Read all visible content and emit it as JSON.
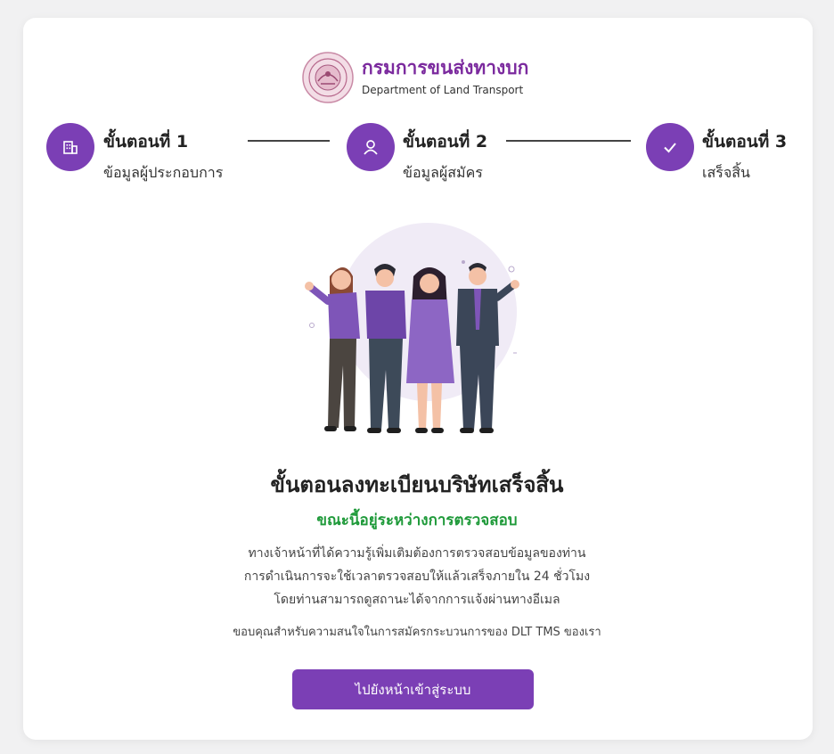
{
  "header": {
    "agency_name_th": "กรมการขนส่งทางบก",
    "agency_name_en": "Department of Land Transport",
    "logo_icon": "dlt-seal-logo"
  },
  "steps": [
    {
      "title": "ขั้นตอนที่ 1",
      "subtitle": "ข้อมูลผู้ประกอบการ",
      "icon": "building-icon",
      "state": "completed"
    },
    {
      "title": "ขั้นตอนที่ 2",
      "subtitle": "ข้อมูลผู้สมัคร",
      "icon": "user-icon",
      "state": "completed"
    },
    {
      "title": "ขั้นตอนที่ 3",
      "subtitle": "เสร็จสิ้น",
      "icon": "check-icon",
      "state": "active"
    }
  ],
  "result": {
    "title": "ขั้นตอนลงทะเบียนบริษัทเสร็จสิ้น",
    "status": "ขณะนี้อยู่ระหว่างการตรวจสอบ",
    "description_lines": [
      "ทางเจ้าหน้าที่ได้ความรู้เพิ่มเติมต้องการตรวจสอบข้อมูลของท่าน",
      "การดำเนินการจะใช้เวลาตรวจสอบให้แล้วเสร็จภายใน 24 ชั่วโมง",
      "โดยท่านสามารถดูสถานะได้จากการแจ้งผ่านทางอีเมล"
    ],
    "thanks": "ขอบคุณสำหรับความสนใจในการสมัครกระบวนการของ DLT TMS ของเรา"
  },
  "cta": {
    "label": "ไปยังหน้าเข้าสู่ระบบ"
  },
  "colors": {
    "primary": "#7b3fb5",
    "brand_text": "#7b2a9e",
    "status_green": "#1f9a3a",
    "background": "#f1f1f2"
  }
}
